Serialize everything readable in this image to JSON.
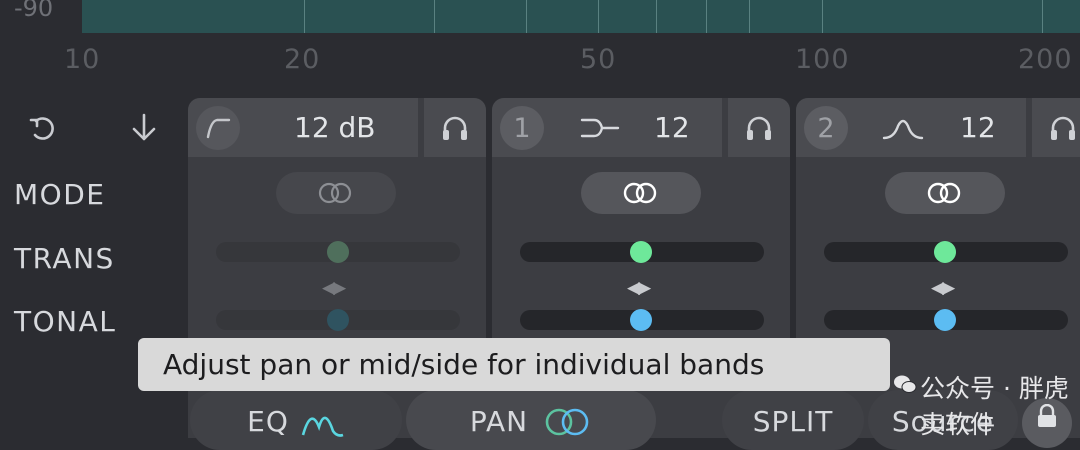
{
  "spectrum": {
    "db_label": "-90",
    "freq_labels": [
      "10",
      "20",
      "50",
      "100",
      "200"
    ]
  },
  "toolbar": {
    "undo_icon": "rotate-icon",
    "down_icon": "arrow-down-icon"
  },
  "rows": {
    "mode": "MODE",
    "trans": "TRANS",
    "tonal": "TONAL"
  },
  "bands": [
    {
      "filter_shape": "highpass",
      "value": "12 dB",
      "mode": "CO",
      "active": false,
      "trans_color": "#4f6f5c",
      "tonal_color": "#2f5360"
    },
    {
      "number": "1",
      "filter_shape": "crossover",
      "value": "12",
      "mode": "CO",
      "active": true,
      "trans_color": "#6ee89a",
      "tonal_color": "#5cbcf2"
    },
    {
      "number": "2",
      "filter_shape": "bell",
      "value": "12",
      "mode": "CO",
      "active": true,
      "trans_color": "#6ee89a",
      "tonal_color": "#5cbcf2"
    }
  ],
  "tooltip": {
    "text": "Adjust pan or mid/side for individual bands"
  },
  "bottom_tabs": {
    "eq": "EQ",
    "pan": "PAN",
    "split": "SPLIT",
    "source": "Source"
  },
  "watermark": {
    "text": "公众号 · 胖虎卖软件"
  },
  "colors": {
    "accent_green": "#6ee89a",
    "accent_blue": "#5cbcf2",
    "spectrum": "#2a5152"
  }
}
